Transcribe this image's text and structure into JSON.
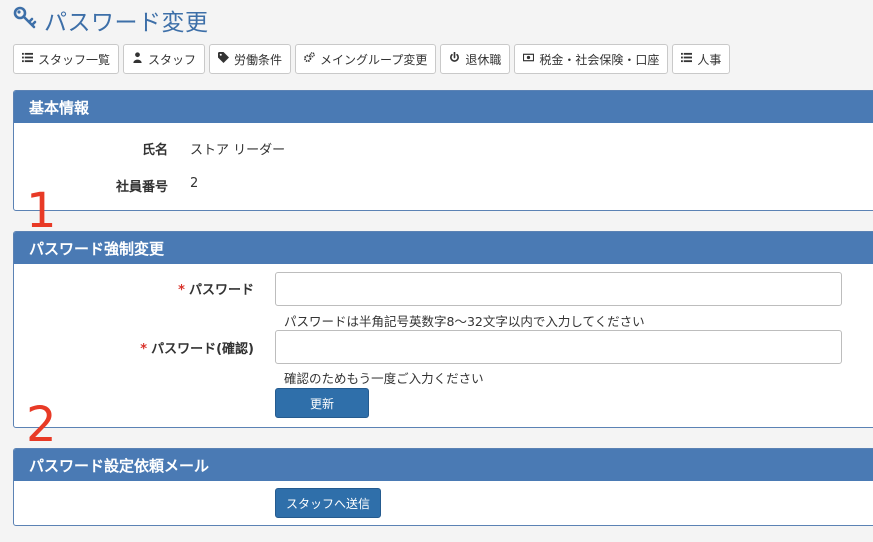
{
  "page": {
    "title": "パスワード変更",
    "icon": "key-icon"
  },
  "toolbar": {
    "buttons": [
      {
        "label": "スタッフ一覧",
        "icon": "list-icon"
      },
      {
        "label": "スタッフ",
        "icon": "user-icon"
      },
      {
        "label": "労働条件",
        "icon": "tag-icon"
      },
      {
        "label": "メイングループ変更",
        "icon": "gears-icon"
      },
      {
        "label": "退休職",
        "icon": "power-icon"
      },
      {
        "label": "税金・社会保険・口座",
        "icon": "money-icon"
      },
      {
        "label": "人事",
        "icon": "list-icon"
      }
    ]
  },
  "basic_info": {
    "heading": "基本情報",
    "name_label": "氏名",
    "name_value": "ストア リーダー",
    "number_label": "社員番号",
    "number_value": "2"
  },
  "annotations": {
    "one": "1",
    "two": "2"
  },
  "force_change": {
    "heading": "パスワード強制変更",
    "required_mark": "*",
    "password_label": "パスワード",
    "password_value": "",
    "password_hint": "パスワードは半角記号英数字8〜32文字以内で入力してください",
    "confirm_label": "パスワード(確認)",
    "confirm_value": "",
    "confirm_hint": "確認のためもう一度ご入力ください",
    "update_button": "更新"
  },
  "request_mail": {
    "heading": "パスワード設定依頼メール",
    "send_button": "スタッフへ送信"
  },
  "colors": {
    "accent": "#4a7ab4",
    "button": "#2f6faa",
    "title": "#3d6fa8",
    "annotation": "#e83a26",
    "required": "#d9332b"
  }
}
